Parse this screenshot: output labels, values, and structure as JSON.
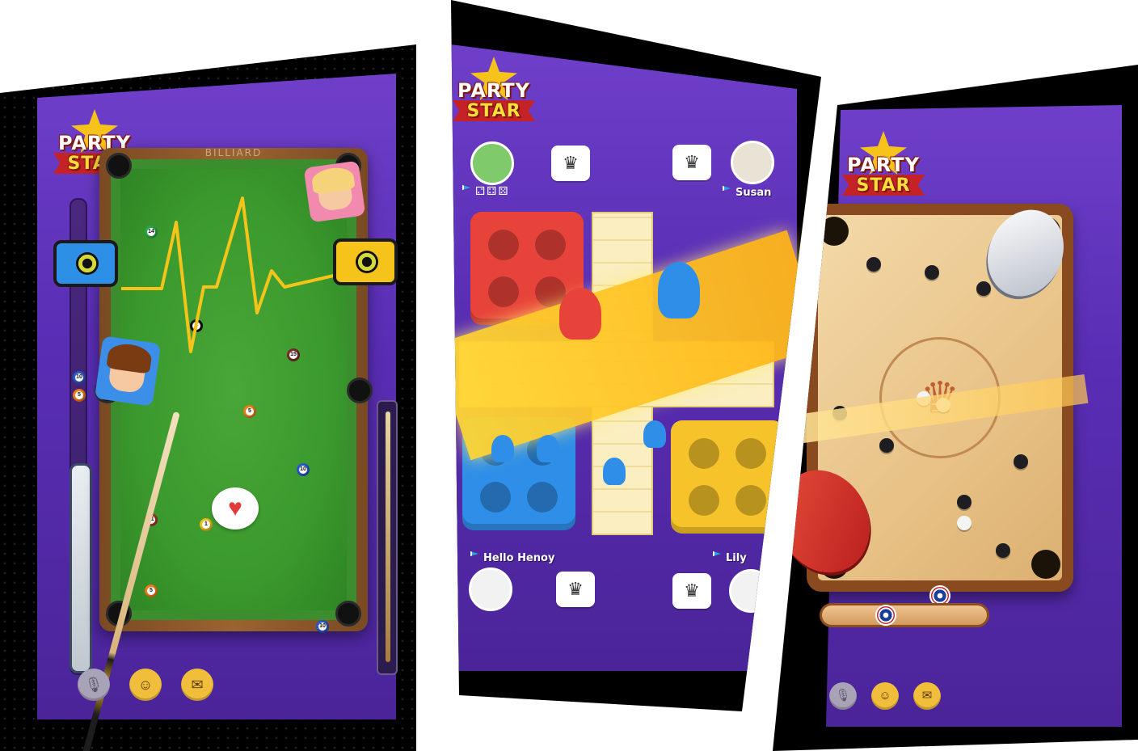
{
  "billiard_screen": {
    "logo": {
      "line1": "PARTY",
      "line2": "STAR"
    },
    "table_title": "BILLIARD",
    "balls": [
      {
        "number": "14",
        "color": "#2aa84a"
      },
      {
        "number": "15",
        "color": "#7a2b2b"
      },
      {
        "number": "5",
        "color": "#f07c1a"
      },
      {
        "number": "10",
        "color": "#2b58c9"
      },
      {
        "number": "11",
        "color": "#b33030"
      },
      {
        "number": "1",
        "color": "#f2c21b"
      },
      {
        "number": "5",
        "color": "#f07c1a"
      },
      {
        "number": "10",
        "color": "#2b58c9"
      }
    ],
    "side_balls": [
      "10",
      "5"
    ],
    "eight_ball_label": "8",
    "buttons": {
      "mic": "mic-icon",
      "emoji": "emoji-icon",
      "chat": "chat-icon"
    }
  },
  "ludo_screen": {
    "logo": {
      "line1": "PARTY",
      "line2": "STAR"
    },
    "players": [
      {
        "name": "",
        "position": "top-left",
        "has_dice": true
      },
      {
        "name": "Susan",
        "position": "top-right"
      },
      {
        "name": "Hello Henoy",
        "position": "bottom-left"
      },
      {
        "name": "Lily",
        "position": "bottom-right"
      }
    ],
    "dice_glyphs": "⚁⚃⚄",
    "crown_glyph": "♛",
    "colors": {
      "red": "#e8433a",
      "blue": "#2f8fe8",
      "yellow": "#f6c32a",
      "green": "#4cbf4c"
    }
  },
  "carrom_screen": {
    "logo": {
      "line1": "PARTY",
      "line2": "STAR"
    },
    "crown_glyph": "♛",
    "buttons": {
      "mic": "mic-icon",
      "emoji": "emoji-icon",
      "chat": "chat-icon"
    }
  }
}
